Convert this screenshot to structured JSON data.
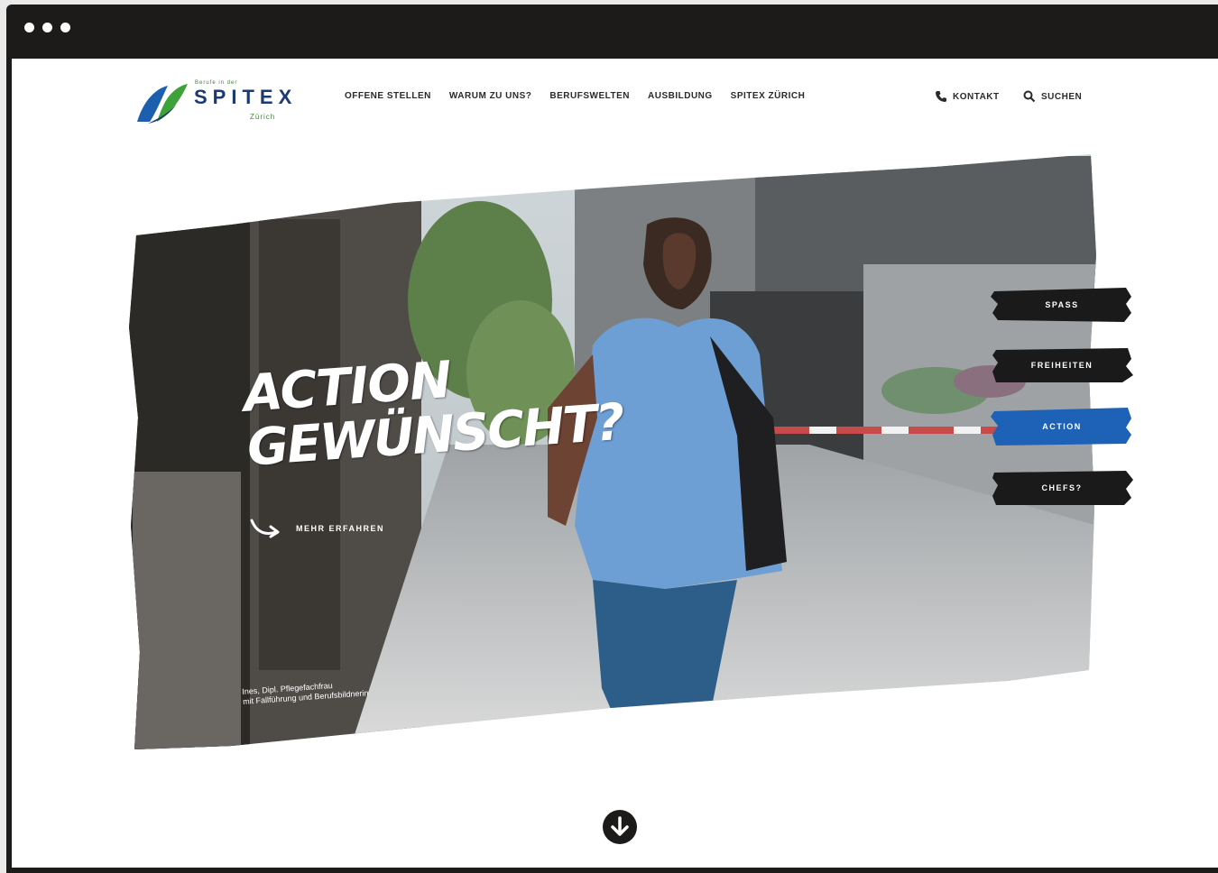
{
  "logo": {
    "tagline": "Berufe in der",
    "wordmark": "SPITEX",
    "city": "Zürich"
  },
  "nav": {
    "items": [
      {
        "label": "OFFENE STELLEN"
      },
      {
        "label": "WARUM ZU UNS?"
      },
      {
        "label": "BERUFSWELTEN"
      },
      {
        "label": "AUSBILDUNG"
      },
      {
        "label": "SPITEX ZÜRICH"
      }
    ],
    "contact": "KONTAKT",
    "search": "SUCHEN"
  },
  "hero": {
    "headline_line1": "ACTION",
    "headline_line2": "GEWÜNSCHT?",
    "more_link": "MEHR ERFAHREN",
    "caption_line1": "Ines, Dipl. Pflegefachfrau",
    "caption_line2": "mit Fallführung und Berufsbildnerin",
    "tags": [
      {
        "label": "SPASS",
        "active": false
      },
      {
        "label": "FREIHEITEN",
        "active": false
      },
      {
        "label": "ACTION",
        "active": true
      },
      {
        "label": "CHEFS?",
        "active": false
      }
    ]
  },
  "colors": {
    "titlebar": "#1c1b19",
    "brand_blue": "#1b3a70",
    "brand_green": "#3c8a3a",
    "tag_dark": "#1a1a1a",
    "tag_active": "#1e62b8"
  },
  "icons": [
    "phone-icon",
    "search-icon",
    "arrow-curve-icon",
    "arrow-down-circle-icon"
  ]
}
